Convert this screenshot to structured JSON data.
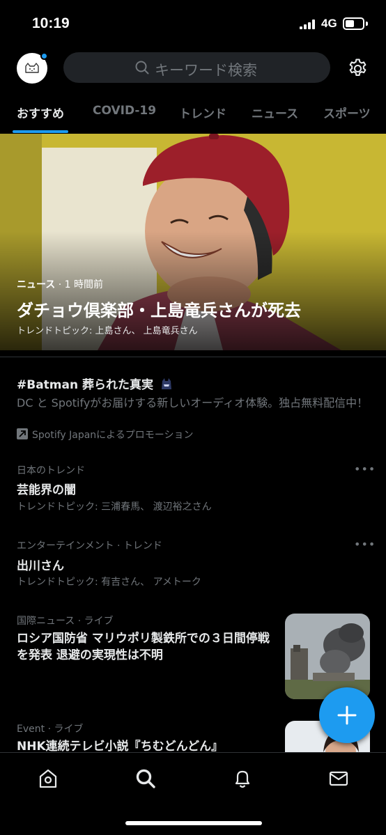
{
  "status_bar": {
    "time": "10:19",
    "network": "4G"
  },
  "header": {
    "search_placeholder": "キーワード検索"
  },
  "tabs": [
    {
      "label": "おすすめ"
    },
    {
      "label": "COVID-19"
    },
    {
      "label": "トレンド"
    },
    {
      "label": "ニュース"
    },
    {
      "label": "スポーツ"
    }
  ],
  "hero": {
    "category": "ニュース",
    "time": "· 1 時間前",
    "title": "ダチョウ倶楽部・上島竜兵さんが死去",
    "subtitle": "トレンドトピック: 上島さん、 上島竜兵さん"
  },
  "promo": {
    "title": "#Batman 葬られた真実",
    "description": "DC と Spotifyがお届けする新しいオーディオ体験。独占無料配信中！",
    "by": "Spotify Japanによるプロモーション"
  },
  "trends": [
    {
      "category": "日本のトレンド",
      "name": "芸能界の闇",
      "subtitle": "トレンドトピック: 三浦春馬、 渡辺裕之さん"
    },
    {
      "category": "エンターテインメント · トレンド",
      "name": "出川さん",
      "subtitle": "トレンドトピック: 有吉さん、 アメトーク"
    }
  ],
  "news": [
    {
      "category": "国際ニュース",
      "tag": "· ライブ",
      "title": "ロシア国防省 マリウポリ製鉄所での３日間停戦を発表 退避の実現性は不明"
    },
    {
      "category": "Event",
      "tag": "· ライブ",
      "title": "NHK連続テレビ小説『ちむどんどん』"
    }
  ],
  "colors": {
    "accent": "#1d9bf0",
    "background": "#000000",
    "muted": "#71767b"
  }
}
